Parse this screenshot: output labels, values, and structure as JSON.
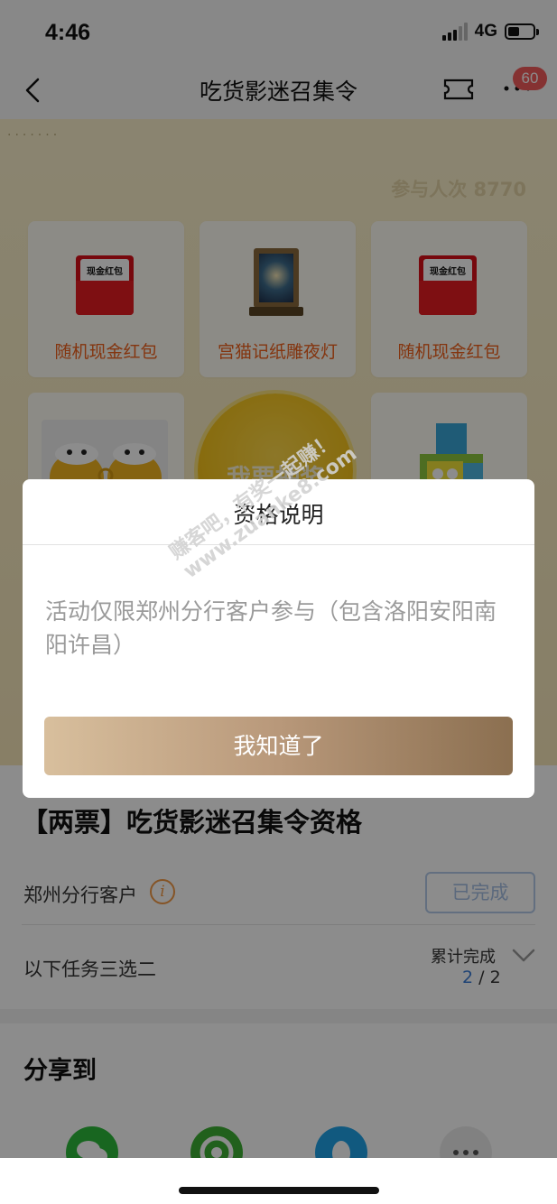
{
  "status_bar": {
    "time": "4:46",
    "network": "4G"
  },
  "nav": {
    "title": "吃货影迷召集令",
    "badge_count": "60"
  },
  "banner": {
    "participants": "参与人次 8770",
    "prizes": [
      {
        "label": "随机现金红包",
        "icon": "red-envelope",
        "envelope_text": "现金红包"
      },
      {
        "label": "宫猫记纸雕夜灯",
        "icon": "paper-carving-lamp"
      },
      {
        "label": "随机现金红包",
        "icon": "red-envelope",
        "envelope_text": "现金红包"
      },
      {
        "icon": "lucky-cat-cups"
      },
      {
        "icon": "spongebob-toy"
      }
    ],
    "draw_button": "我要抽奖"
  },
  "tasks": {
    "title": "【两票】吃货影迷召集令资格",
    "row1_label": "郑州分行客户",
    "row1_status": "已完成",
    "row2_label": "以下任务三选二",
    "progress_label": "累计完成",
    "progress_current": "2",
    "progress_sep": " / ",
    "progress_total": "2"
  },
  "share": {
    "title": "分享到",
    "targets": [
      "wechat-icon",
      "moments-icon",
      "qq-icon",
      "more-icon"
    ]
  },
  "dialog": {
    "title": "资格说明",
    "body": "活动仅限郑州分行客户参与（包含洛阳安阳南阳许昌）",
    "confirm": "我知道了"
  },
  "watermark": {
    "line1": "赚客吧，有奖一起赚！",
    "line2": "www.zuanke8.com"
  },
  "colors": {
    "accent_orange": "#f0611d",
    "badge_red": "#f25b5b",
    "progress_blue": "#3a7bd5",
    "button_gold": "#b8987a"
  }
}
